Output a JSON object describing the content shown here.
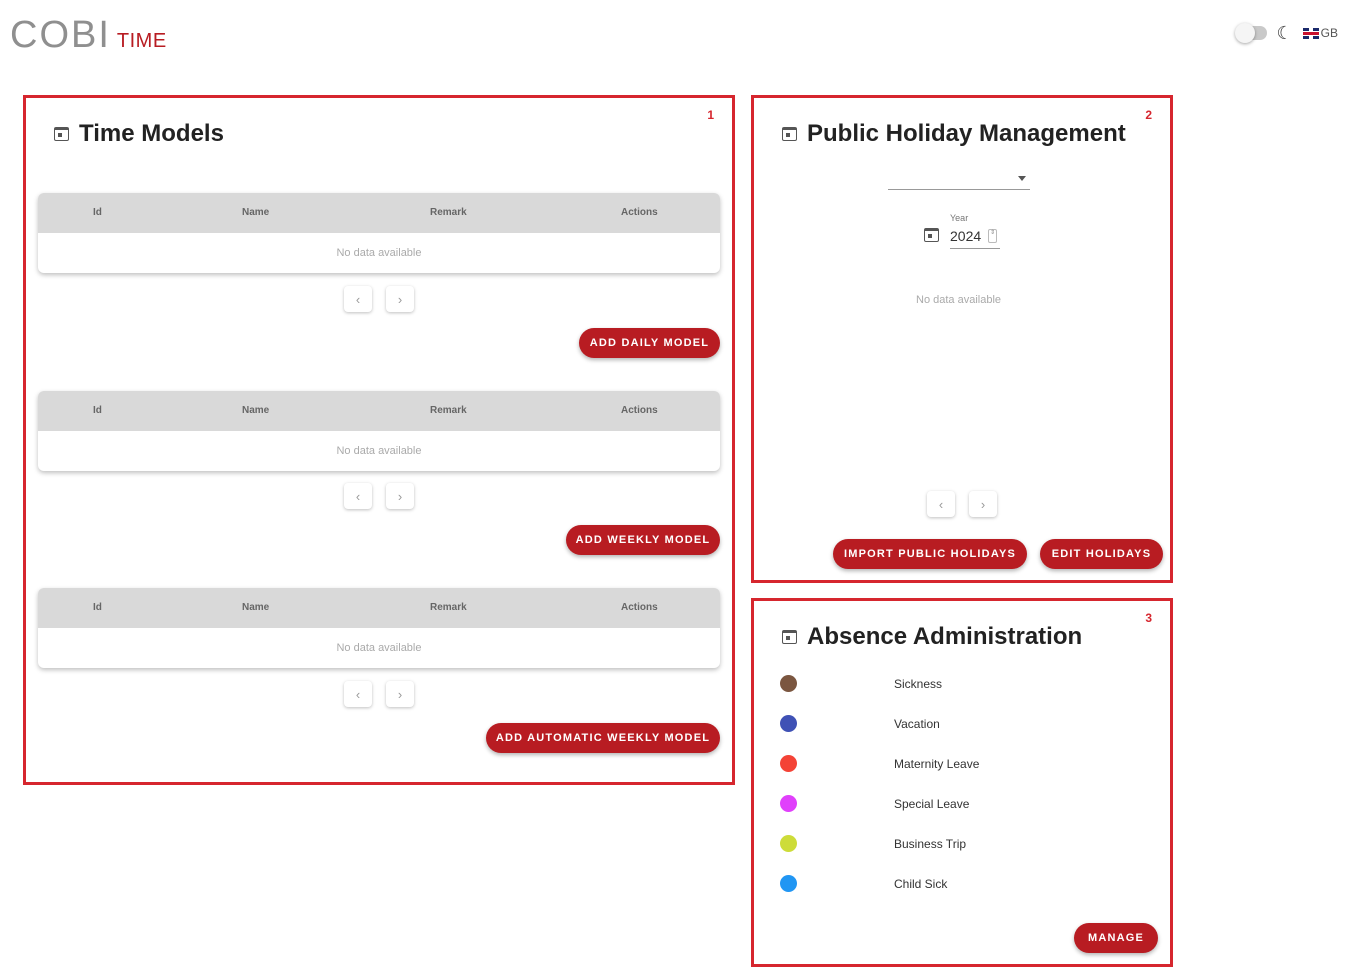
{
  "header": {
    "logo_main": "COBI",
    "logo_sub": "TIME",
    "moon_glyph": "☾",
    "language": "GB"
  },
  "time_models": {
    "title": "Time Models",
    "number": "1",
    "tables": [
      {
        "columns": [
          "Id",
          "Name",
          "Remark",
          "Actions"
        ],
        "empty_text": "No data available",
        "prev": "‹",
        "next": "›",
        "button": "ADD DAILY MODEL"
      },
      {
        "columns": [
          "Id",
          "Name",
          "Remark",
          "Actions"
        ],
        "empty_text": "No data available",
        "prev": "‹",
        "next": "›",
        "button": "ADD WEEKLY MODEL"
      },
      {
        "columns": [
          "Id",
          "Name",
          "Remark",
          "Actions"
        ],
        "empty_text": "No data available",
        "prev": "‹",
        "next": "›",
        "button": "ADD AUTOMATIC WEEKLY MODEL"
      }
    ]
  },
  "public_holiday": {
    "title": "Public Holiday Management",
    "number": "2",
    "year_label": "Year",
    "year_value": "2024",
    "spin_glyph": "⇕",
    "empty_text": "No data available",
    "prev": "‹",
    "next": "›",
    "import_button": "IMPORT PUBLIC HOLIDAYS",
    "edit_button": "EDIT HOLIDAYS"
  },
  "absence": {
    "title": "Absence Administration",
    "number": "3",
    "types": [
      {
        "label": "Sickness",
        "color": "#7b5640"
      },
      {
        "label": "Vacation",
        "color": "#3f51b5"
      },
      {
        "label": "Maternity Leave",
        "color": "#f44336"
      },
      {
        "label": "Special Leave",
        "color": "#e040fb"
      },
      {
        "label": "Business Trip",
        "color": "#cddc39"
      },
      {
        "label": "Child Sick",
        "color": "#2196f3"
      }
    ],
    "manage_button": "MANAGE"
  },
  "colors": {
    "accent": "#b81c22",
    "panel_border": "#d6262e",
    "table_header": "#d9d9d9"
  }
}
